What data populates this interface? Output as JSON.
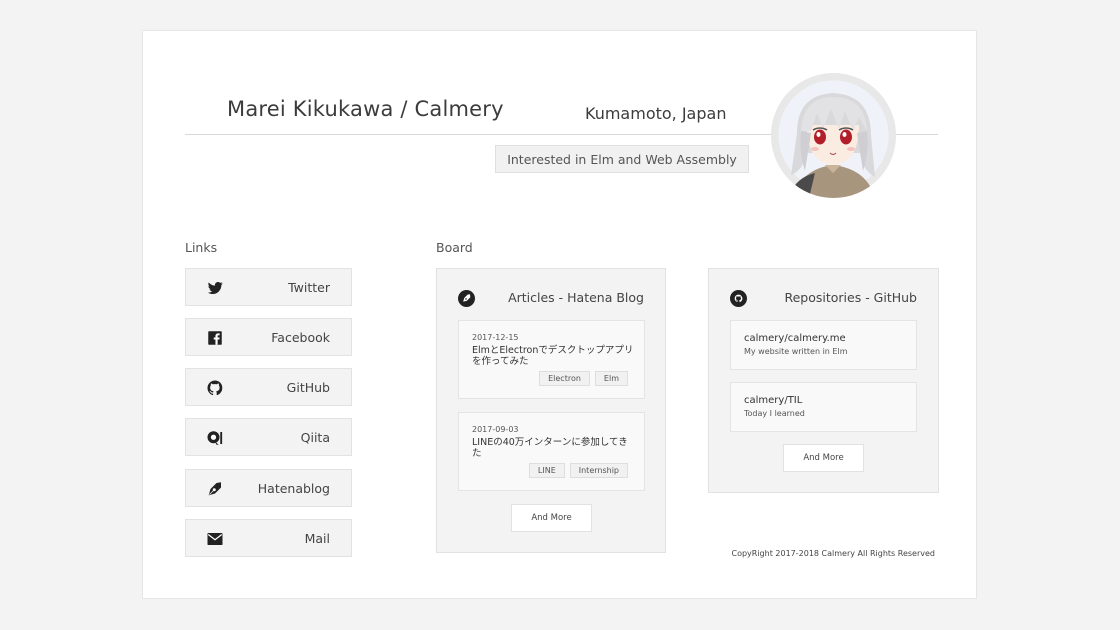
{
  "profile": {
    "name": "Marei Kikukawa / Calmery",
    "location": "Kumamoto, Japan",
    "interest": "Interested in Elm and Web Assembly"
  },
  "links": {
    "title": "Links",
    "items": [
      {
        "label": "Twitter",
        "icon": "twitter-icon"
      },
      {
        "label": "Facebook",
        "icon": "facebook-icon"
      },
      {
        "label": "GitHub",
        "icon": "github-icon"
      },
      {
        "label": "Qiita",
        "icon": "qiita-icon"
      },
      {
        "label": "Hatenablog",
        "icon": "hatenablog-icon"
      },
      {
        "label": "Mail",
        "icon": "mail-icon"
      }
    ]
  },
  "board": {
    "title": "Board",
    "articles": {
      "title": "Articles - Hatena Blog",
      "items": [
        {
          "date": "2017-12-15",
          "title": "ElmとElectronでデスクトップアプリを作ってみた",
          "tags": [
            "Electron",
            "Elm"
          ]
        },
        {
          "date": "2017-09-03",
          "title": "LINEの40万インターンに参加してきた",
          "tags": [
            "LINE",
            "Internship"
          ]
        }
      ],
      "more": "And More"
    },
    "repositories": {
      "title": "Repositories - GitHub",
      "items": [
        {
          "name": "calmery/calmery.me",
          "description": "My website written in Elm"
        },
        {
          "name": "calmery/TIL",
          "description": "Today I learned"
        }
      ],
      "more": "And More"
    }
  },
  "footer": {
    "copyright": "CopyRight 2017-2018 Calmery All Rights Reserved"
  }
}
